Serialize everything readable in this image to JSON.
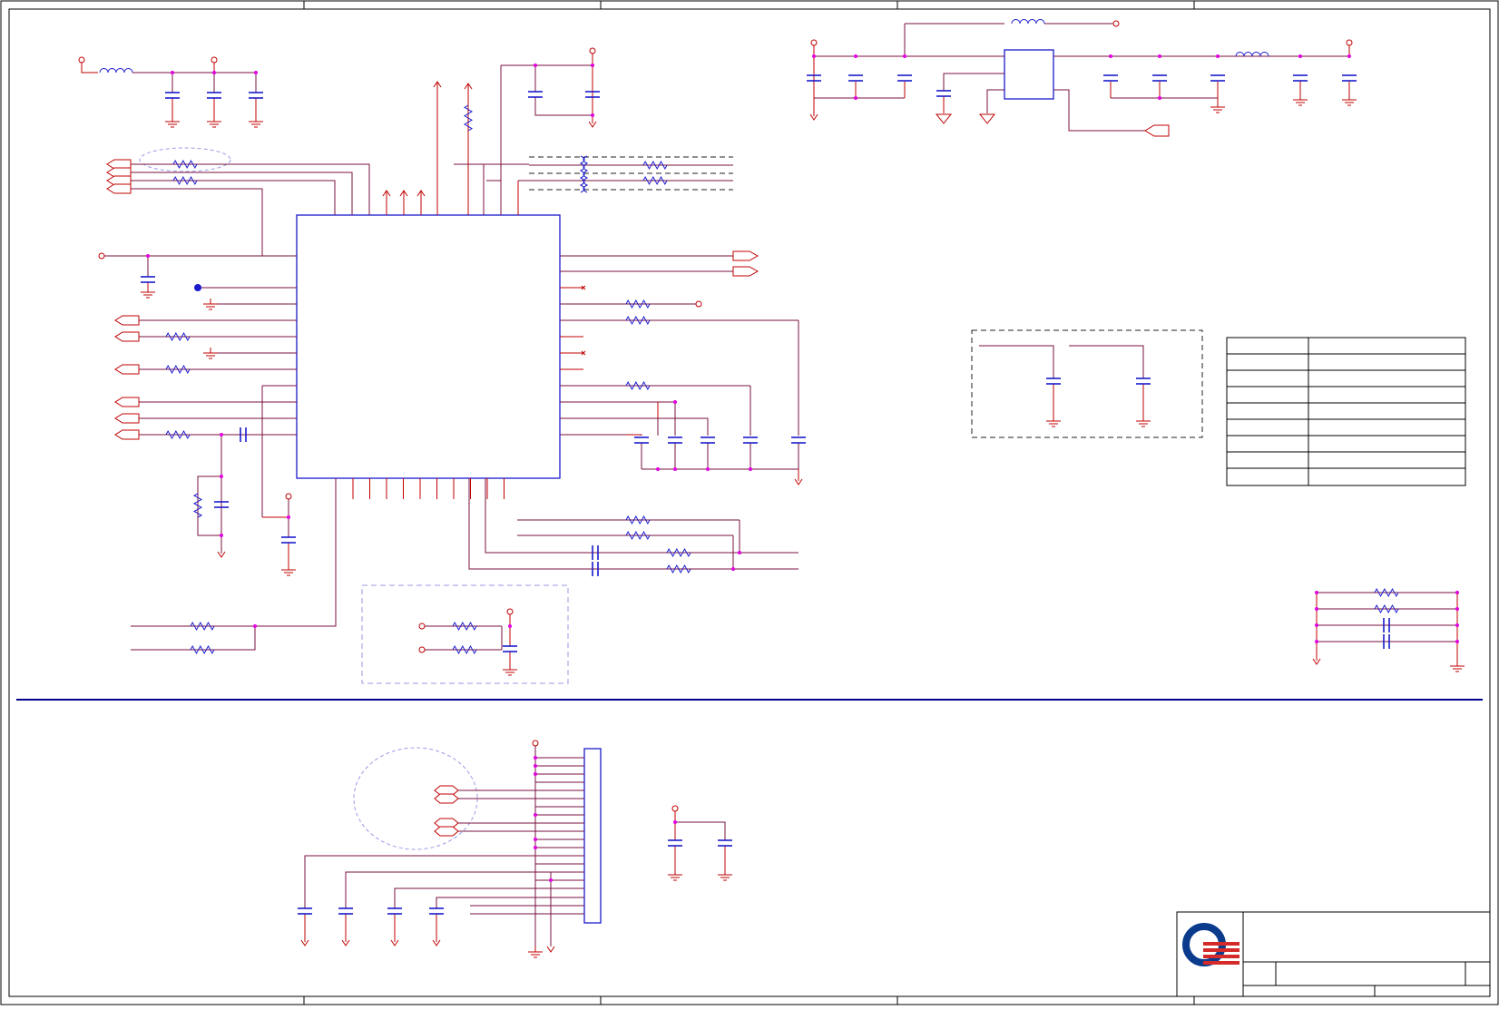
{
  "colors": {
    "wire": "#c00000",
    "bus": "#7a1040",
    "part": "#1a1acc",
    "junction": "#e000e0",
    "frame": "#000000",
    "divider": "#00008b",
    "dashed_box": "#9a9ae6",
    "logo_blue": "#0b3b8c",
    "logo_red": "#d42a2a"
  },
  "icons": {
    "logo": "company-logo-icon",
    "ground": "ground-icon",
    "power_port": "power-port-icon",
    "offpage_connector": "offpage-connector-icon"
  },
  "title_block": {
    "title": "",
    "size": "",
    "document_number": "",
    "rev": "",
    "date": "",
    "sheet": ""
  },
  "revision_table": {
    "headers": [
      "",
      ""
    ],
    "rows": [
      [
        "",
        ""
      ],
      [
        "",
        ""
      ],
      [
        "",
        ""
      ],
      [
        "",
        ""
      ],
      [
        "",
        ""
      ],
      [
        "",
        ""
      ],
      [
        "",
        ""
      ]
    ]
  },
  "main_ic": {
    "label": ""
  },
  "connector": {
    "label": ""
  },
  "regulator": {
    "label": ""
  }
}
